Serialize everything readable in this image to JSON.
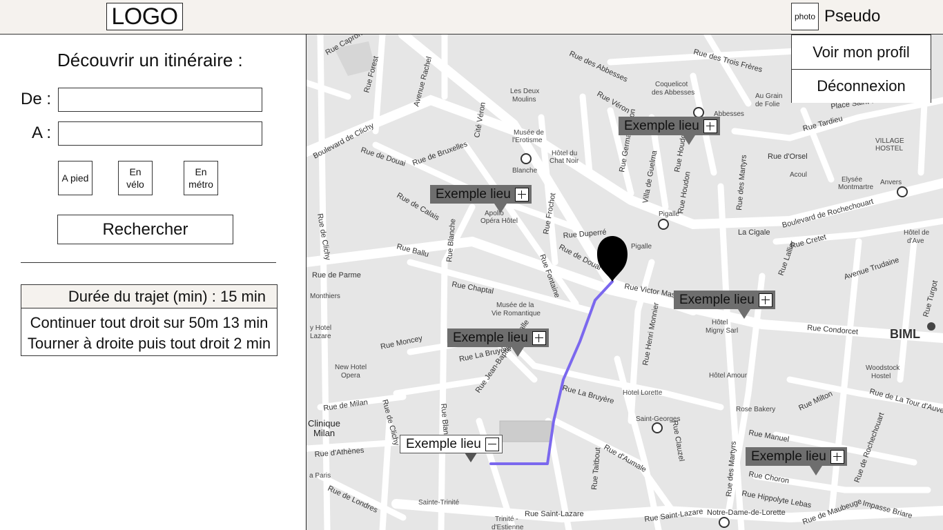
{
  "header": {
    "logo": "LOGO",
    "user_photo": "photo",
    "user_name": "Pseudo"
  },
  "profile_menu": {
    "items": [
      "Voir mon profil",
      "Déconnexion"
    ]
  },
  "search": {
    "title": "Découvrir un itinéraire :",
    "from_label": "De :",
    "to_label": "A :",
    "from_value": "",
    "to_value": "",
    "modes": [
      {
        "label_line1": "A pied",
        "label_line2": ""
      },
      {
        "label_line1": "En",
        "label_line2": "vélo"
      },
      {
        "label_line1": "En",
        "label_line2": "métro"
      }
    ],
    "submit_label": "Rechercher"
  },
  "result": {
    "duration": "Durée du trajet (min) : 15 min",
    "steps": [
      "Continuer tout droit sur 50m 13 min",
      "Tourner à droite puis tout droit 2 min"
    ]
  },
  "map": {
    "route_color": "#7b68ee",
    "marker_color": "#000000",
    "places": [
      {
        "label": "Exemple lieu",
        "state": "add"
      },
      {
        "label": "Exemple lieu",
        "state": "add"
      },
      {
        "label": "Exemple lieu",
        "state": "add"
      },
      {
        "label": "Exemple lieu",
        "state": "add"
      },
      {
        "label": "Exemple lieu",
        "state": "remove"
      },
      {
        "label": "Exemple lieu",
        "state": "add"
      }
    ],
    "streets": [
      "Rue Capron",
      "Rue Forest",
      "Avenue Rachel",
      "Rue des Abbesses",
      "Rue des Trois Frères",
      "Rue Véron",
      "Coquelicot des Abbesses",
      "Au Grain de Folie",
      "Place Saint-Pierre",
      "Boulevard de Clichy",
      "Rue de Douai",
      "Rue de Bruxelles",
      "Musée de l'Erotisme",
      "Hôtel du Chat Noir",
      "Blanche",
      "Abbesses",
      "Rue Tardieu",
      "VILLAGE HOSTEL",
      "Rue d'Orsel",
      "Elysée Montmartre",
      "Anvers",
      "Pigalle",
      "La Cigale",
      "Boulevard de Rochechouart",
      "Rue de Calais",
      "Apollo Opéra Hôtel",
      "Rue Duperré",
      "Rue de Clichy",
      "Villa Ballu",
      "Rue Ballu",
      "Rue Blanche",
      "Rue Fontaine",
      "Rue de Douai",
      "Avenue Trudaine",
      "Rue Victor Massé",
      "Rue Chaptal",
      "Musée de la Vie Romantique",
      "Rue Condorcet",
      "Hôtel Migny Sarl",
      "BIML",
      "Rue Moncey",
      "Rue La Bruyère",
      "Rue Jean-Baptiste Pigalle",
      "Hôtel Lorette",
      "Woodstock Hostel",
      "Hôtel Amour",
      "Rue de Milan",
      "Clinique Milan",
      "Rue d'Athènes",
      "Saint-Georges",
      "Rose Bakery",
      "Rue Milton",
      "Rue de La Tour d'Auvergne",
      "Rue Manuel",
      "Rue Choron",
      "Rue Hippolyte Lebas",
      "Rue de Londres",
      "Sainte-Trinité",
      "Rue Saint-Lazare",
      "Notre-Dame-de-Lorette",
      "Rue de Maubeuge",
      "Impasse Briare",
      "Rue Turgot",
      "Rue de Rochechouart",
      "Rue d'Aumale",
      "Rue Taitbout",
      "Rue Henri Monnier",
      "Rue des Martyrs",
      "Rue Lallier",
      "Rue Clauzel",
      "Cité Véron",
      "Rue Germain Pilon",
      "Villa de Guelma",
      "Rue Houdon",
      "Rue Frochot",
      "Rue Pierre Fontaine",
      "Rue Cretet",
      "Les Deux Moulins",
      "Monthiers",
      "New Hotel Opera",
      "Hotel Lazare",
      "Rue de Parme",
      "Trinité - d'Estienne",
      "Montmartre",
      "Vie Romantique"
    ]
  }
}
